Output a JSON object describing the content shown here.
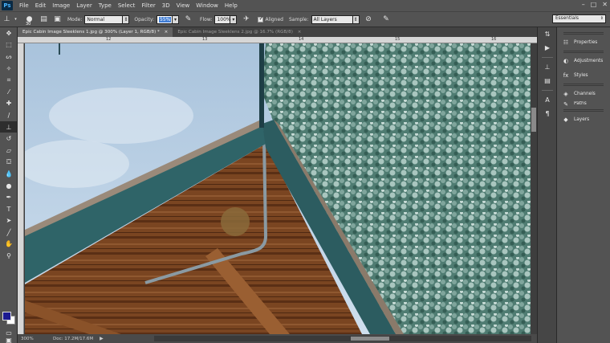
{
  "app": {
    "logo": "Ps"
  },
  "menu": [
    "File",
    "Edit",
    "Image",
    "Layer",
    "Type",
    "Select",
    "Filter",
    "3D",
    "View",
    "Window",
    "Help"
  ],
  "window_controls": [
    "–",
    "□",
    "✕"
  ],
  "options_bar": {
    "brush_size": "30",
    "mode_label": "Mode:",
    "mode_value": "Normal",
    "opacity_label": "Opacity:",
    "opacity_value": "55%",
    "flow_label": "Flow:",
    "flow_value": "100%",
    "aligned_label": "Aligned",
    "sample_label": "Sample:",
    "sample_value": "All Layers",
    "workspace": "Essentials"
  },
  "tabs": [
    {
      "label": "Epic Cabin Image Sleeklens 1.jpg @ 300% (Layer 1, RGB/8) *",
      "close": "×",
      "active": true
    },
    {
      "label": "Epic Cabin Image Sleeklens 2.jpg @ 16.7% (RGB/8)",
      "close": "×",
      "active": false
    }
  ],
  "ruler_numbers": [
    "12",
    "13",
    "14",
    "15",
    "16"
  ],
  "status": {
    "zoom": "300%",
    "doc": "Doc: 17.2M/17.6M",
    "arrow": "▶"
  },
  "panels": [
    {
      "icon": "properties-icon",
      "glyph": "☷",
      "label": "Properties"
    },
    {
      "icon": "adjustments-icon",
      "glyph": "◐",
      "label": "Adjustments"
    },
    {
      "icon": "styles-icon",
      "glyph": "fx",
      "label": "Styles"
    },
    {
      "icon": "channels-icon",
      "glyph": "◈",
      "label": "Channels"
    },
    {
      "icon": "paths-icon",
      "glyph": "✎",
      "label": "Paths"
    },
    {
      "icon": "layers-icon",
      "glyph": "◆",
      "label": "Layers"
    }
  ],
  "colors": {
    "foreground": "#1c1a91",
    "background": "#ffffff",
    "accent": "#3d7bd4"
  }
}
